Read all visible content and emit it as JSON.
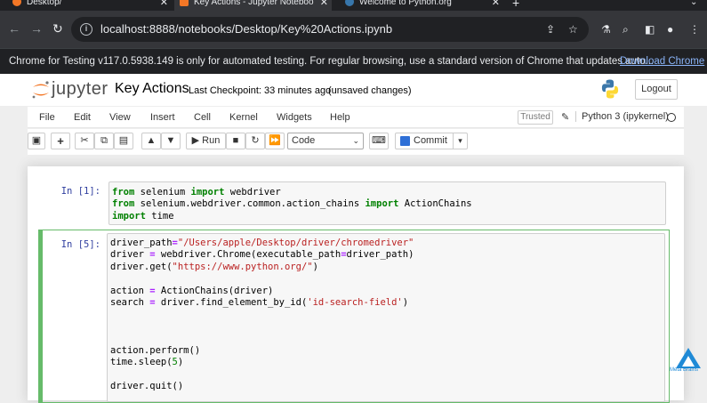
{
  "tabs": [
    {
      "title": "Desktop/",
      "active": false
    },
    {
      "title": "Key Actions - Jupyter Noteboo",
      "active": true
    },
    {
      "title": "Welcome to Python.org",
      "active": false
    }
  ],
  "newtab_label": "+",
  "address": {
    "url": "localhost:8888/notebooks/Desktop/Key%20Actions.ipynb"
  },
  "infobar": {
    "message": "Chrome for Testing v117.0.5938.149 is only for automated testing. For regular browsing, use a standard version of Chrome that updates auto...",
    "link": "Download Chrome"
  },
  "jupyter": {
    "logo_text": "jupyter",
    "notebook_name": "Key Actions",
    "checkpoint": "Last Checkpoint: 33 minutes ago",
    "unsaved": "(unsaved changes)",
    "logout": "Logout"
  },
  "menu": {
    "items": [
      "File",
      "Edit",
      "View",
      "Insert",
      "Cell",
      "Kernel",
      "Widgets",
      "Help"
    ],
    "trusted": "Trusted",
    "kernel": "Python 3 (ipykernel)"
  },
  "toolbar": {
    "run_label": "Run",
    "cell_type": "Code",
    "commit_label": "Commit"
  },
  "cells": [
    {
      "prompt": "In [1]:"
    },
    {
      "prompt": "In [5]:"
    }
  ],
  "watermark": "Meta Brains",
  "colors": {
    "chrome_dark": "#202124",
    "chrome_toolbar": "#35363a",
    "link_blue": "#8ab4f8",
    "cell_selected_border": "#66bb6a",
    "prompt_blue": "#303f9f",
    "keyword_green": "#008000",
    "string_red": "#ba2121"
  }
}
